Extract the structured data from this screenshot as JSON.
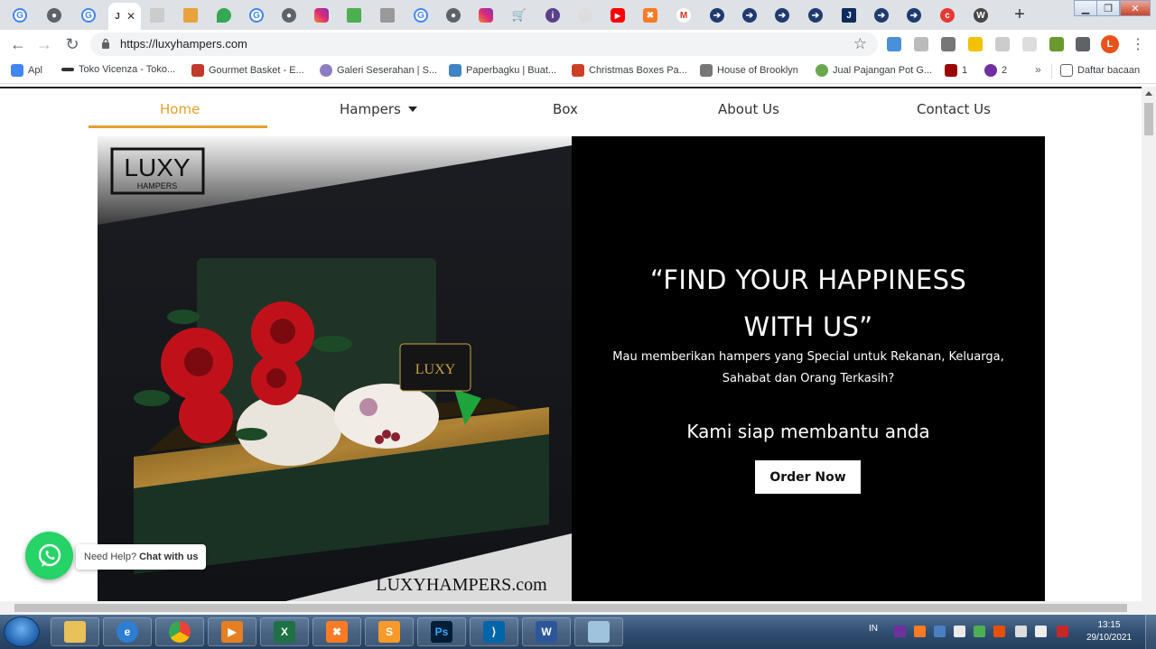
{
  "browser": {
    "url": "https://luxyhampers.com",
    "profile_initial": "L",
    "bookmarks": [
      {
        "label": "Apl",
        "color": "#4285f4"
      },
      {
        "label": "Toko Vicenza - Toko...",
        "color": "#333333"
      },
      {
        "label": "Gourmet Basket - E...",
        "color": "#c0392b"
      },
      {
        "label": "Galeri Seserahan | S...",
        "color": "#8e7cc3"
      },
      {
        "label": "Paperbagku | Buat...",
        "color": "#3d85c6"
      },
      {
        "label": "Christmas Boxes Pa...",
        "color": "#cc4125"
      },
      {
        "label": "House of Brooklyn",
        "color": "#555555"
      },
      {
        "label": "Jual Pajangan Pot G...",
        "color": "#6aa84f"
      },
      {
        "label": "1",
        "color": "#990000"
      },
      {
        "label": "2",
        "color": "#7030a0"
      }
    ],
    "bookmarks_more": "»",
    "reading_list": "Daftar bacaan"
  },
  "nav": {
    "items": [
      "Home",
      "Hampers",
      "Box",
      "About Us",
      "Contact Us"
    ]
  },
  "hero": {
    "brand_logo_text": "LUXY",
    "brand_logo_sub": "HAMPERS",
    "watermark": "LUXYHAMPERS.com",
    "tagline_line1": "“FIND YOUR HAPPINESS",
    "tagline_line2": "WITH US”",
    "subtitle_line1": "Mau memberikan hampers yang Special untuk Rekanan, Keluarga,",
    "subtitle_line2": "Sahabat dan Orang Terkasih?",
    "help_text": "Kami siap membantu anda",
    "cta": "Order Now"
  },
  "whatsapp": {
    "prefix": "Need Help?",
    "cta": "Chat with us"
  },
  "taskbar": {
    "lang": "IN",
    "time": "13:15",
    "date": "29/10/2021"
  },
  "colors": {
    "accent": "#e5a02c",
    "whatsapp": "#25d366",
    "hero_bg": "#000000"
  }
}
